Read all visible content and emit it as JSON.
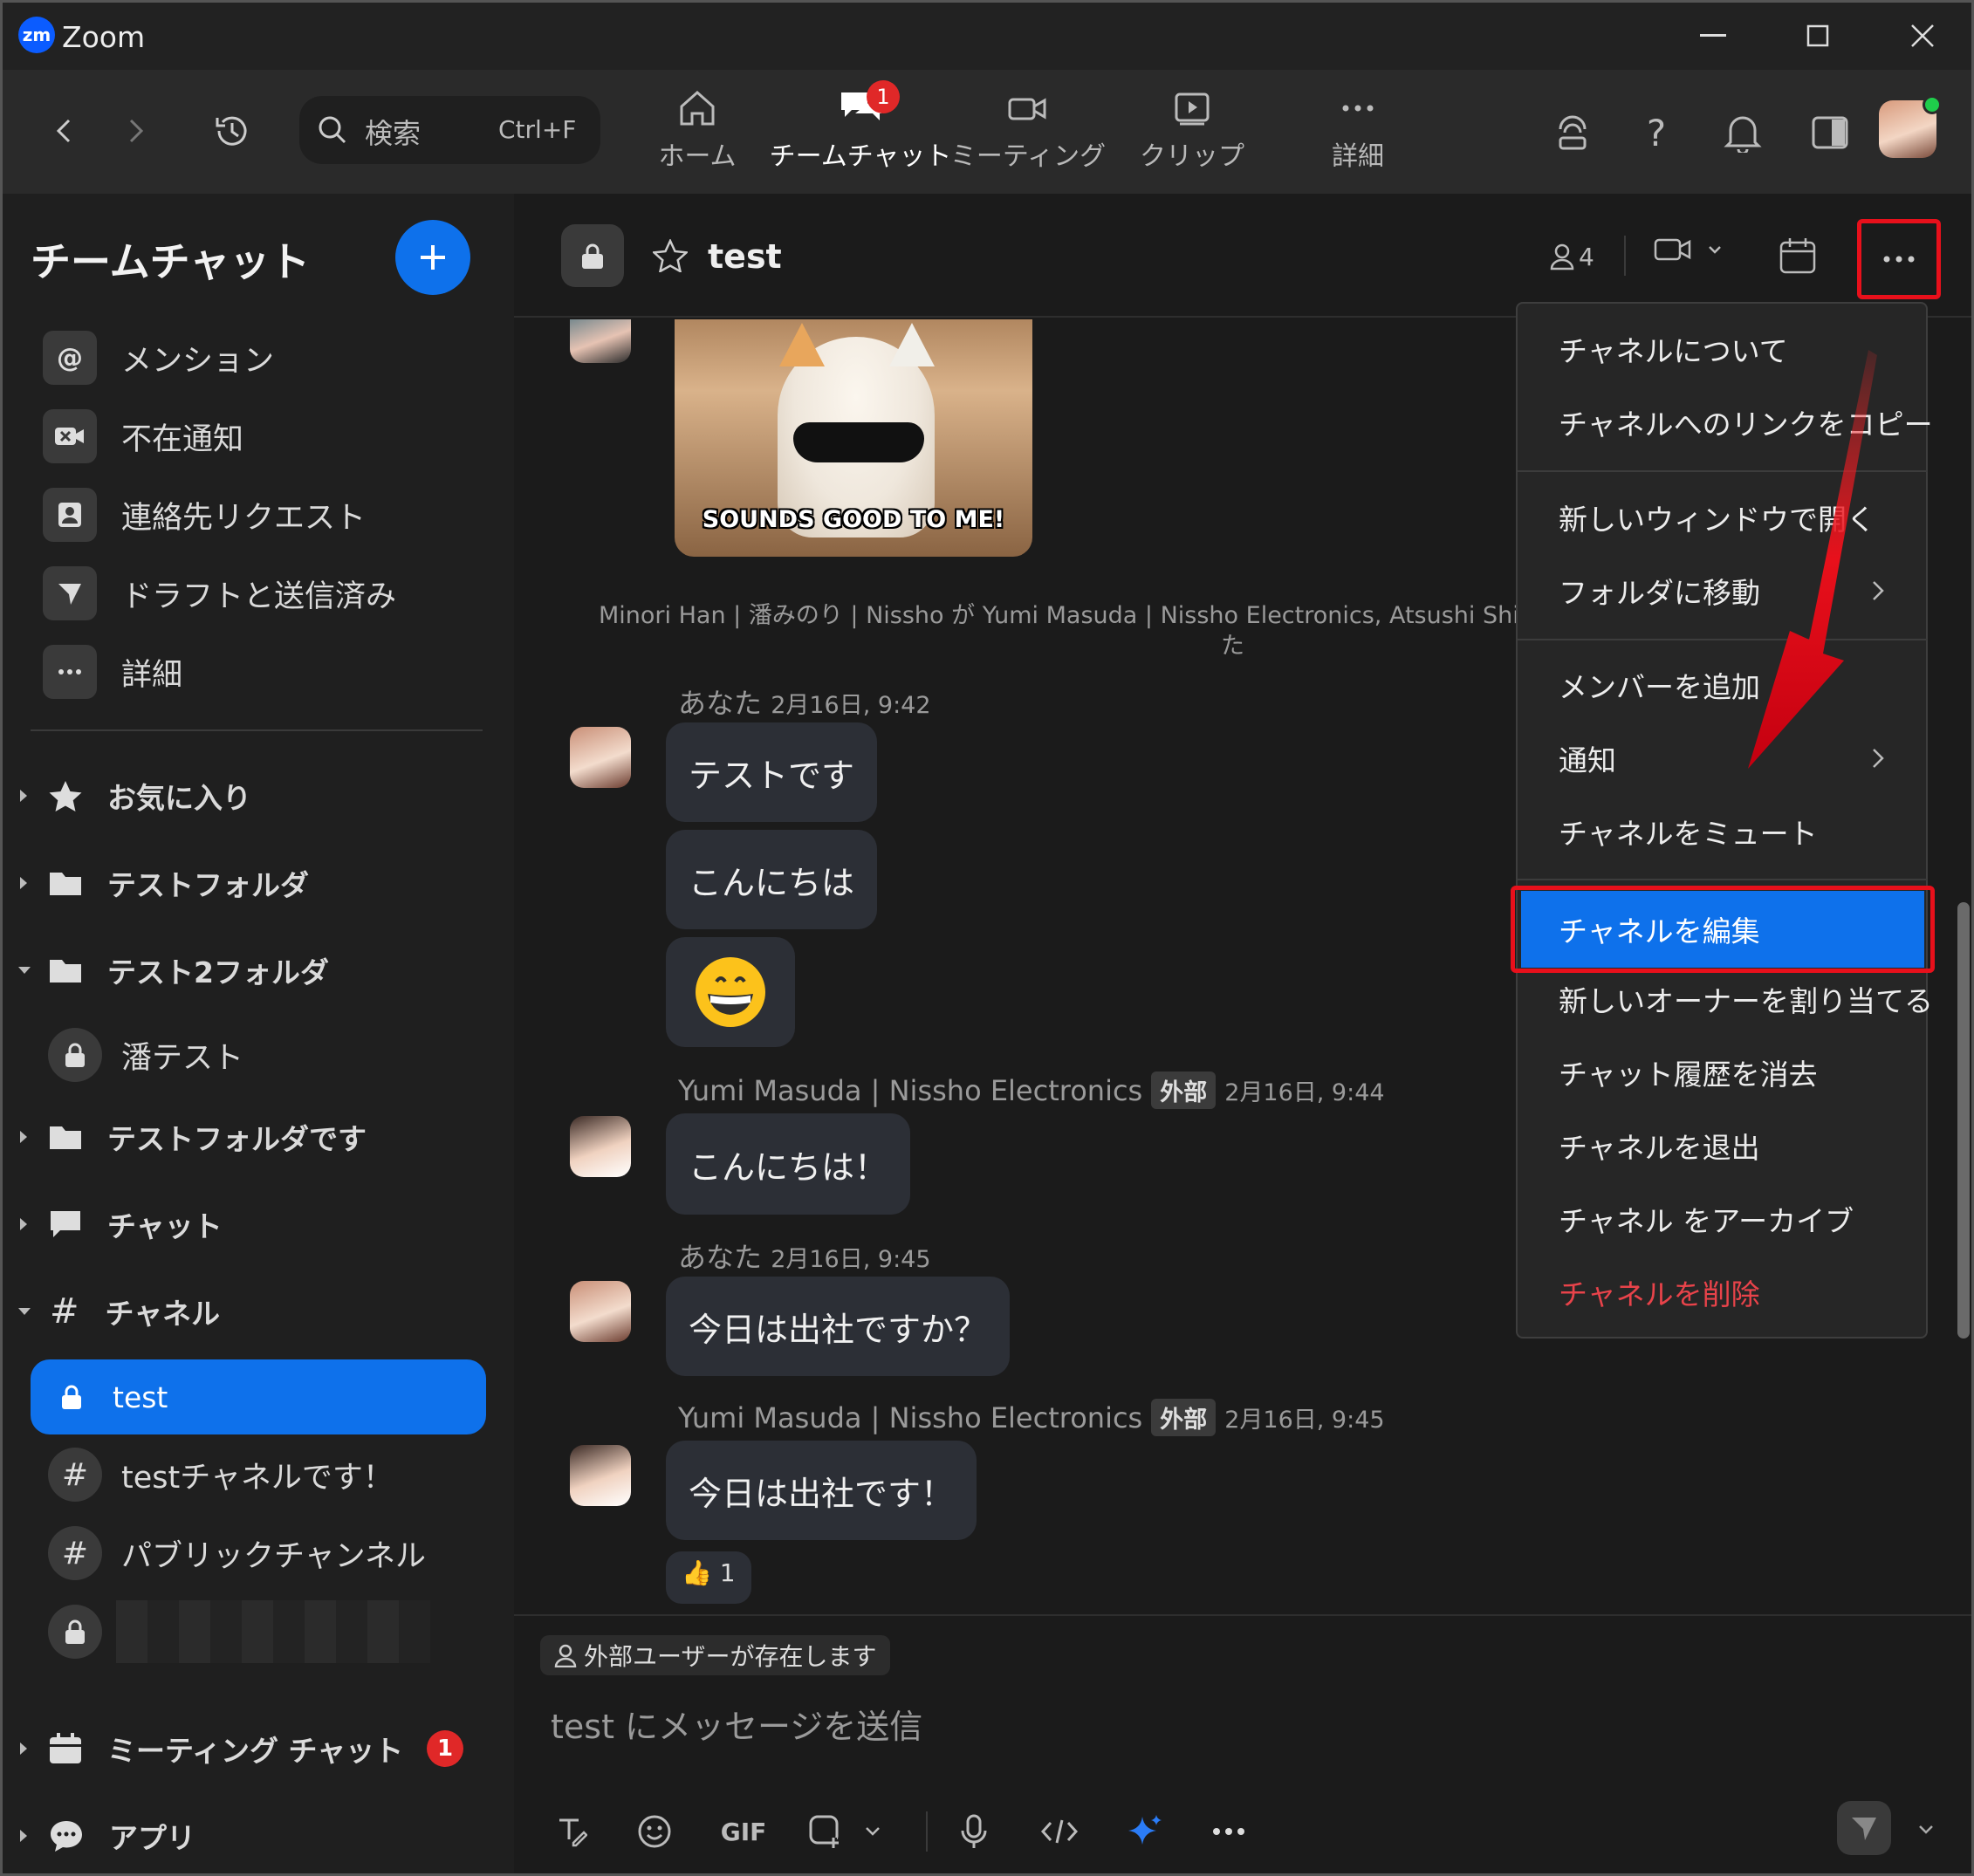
{
  "window": {
    "app_name": "Zoom",
    "logo": "zm"
  },
  "toolbar": {
    "search_placeholder": "検索",
    "search_shortcut": "Ctrl+F",
    "tabs": [
      {
        "label": "ホーム",
        "icon": "home-icon"
      },
      {
        "label": "チームチャット",
        "icon": "team-chat-icon",
        "badge": "1",
        "active": true
      },
      {
        "label": "ミーティング",
        "icon": "video-camera-icon"
      },
      {
        "label": "クリップ",
        "icon": "clip-icon"
      },
      {
        "label": "詳細",
        "icon": "more-dots-icon"
      }
    ]
  },
  "sidebar": {
    "title": "チームチャット",
    "quick_items": [
      {
        "label": "メンション",
        "icon": "at-icon"
      },
      {
        "label": "不在通知",
        "icon": "missed-video-icon"
      },
      {
        "label": "連絡先リクエスト",
        "icon": "contact-icon"
      },
      {
        "label": "ドラフトと送信済み",
        "icon": "send-icon"
      },
      {
        "label": "詳細",
        "icon": "more-dots-icon"
      }
    ],
    "sections": [
      {
        "label": "お気に入り",
        "icon": "star-icon",
        "expanded": false
      },
      {
        "label": "テストフォルダ",
        "icon": "folder-icon",
        "expanded": false
      },
      {
        "label": "テスト2フォルダ",
        "icon": "folder-icon",
        "expanded": true
      },
      {
        "label": "潘テスト",
        "icon": "lock-icon",
        "child": true
      },
      {
        "label": "テストフォルダです",
        "icon": "folder-icon",
        "expanded": false
      },
      {
        "label": "チャット",
        "icon": "chat-bubble-icon",
        "expanded": false
      },
      {
        "label": "チャネル",
        "icon": "hash-icon",
        "expanded": true
      }
    ],
    "channels": [
      {
        "label": "test",
        "icon": "lock-icon",
        "selected": true
      },
      {
        "label": "testチャネルです！",
        "icon": "hash-icon"
      },
      {
        "label": "パブリックチャンネル",
        "icon": "hash-icon"
      },
      {
        "label": "",
        "icon": "lock-icon",
        "redacted": true
      }
    ],
    "bottom_sections": [
      {
        "label": "ミーティング チャット",
        "icon": "calendar-icon",
        "badge": "1"
      },
      {
        "label": "アプリ",
        "icon": "app-bubble-icon"
      }
    ]
  },
  "channel_header": {
    "name": "test",
    "member_count": "4"
  },
  "messages": {
    "gif_caption": "SOUNDS GOOD TO ME!",
    "system_line_1": "Minori Han | 潘みのり | Nissho が Yumi Masuda | Nissho Electronics,  Atsushi Shibata",
    "system_line_2": "た",
    "groups": [
      {
        "sender": "あなた",
        "time": "2月16日, 9:42",
        "bubbles": [
          "テストです",
          "こんにちは",
          "😁"
        ]
      },
      {
        "sender": "Yumi Masuda | Nissho Electronics",
        "external": "外部",
        "time": "2月16日, 9:44",
        "bubbles": [
          "こんにちは！"
        ]
      },
      {
        "sender": "あなた",
        "time": "2月16日, 9:45",
        "bubbles": [
          "今日は出社ですか？"
        ]
      },
      {
        "sender": "Yumi Masuda | Nissho Electronics",
        "external": "外部",
        "time": "2月16日, 9:45",
        "bubbles": [
          "今日は出社です！"
        ],
        "reaction": "👍 1"
      }
    ]
  },
  "composer": {
    "external_notice": "外部ユーザーが存在します",
    "placeholder": "test にメッセージを送信",
    "gif_label": "GIF"
  },
  "context_menu": {
    "groups": [
      [
        "チャネルについて",
        "チャネルへのリンクをコピー"
      ],
      [
        "新しいウィンドウで開く",
        "フォルダに移動"
      ],
      [
        "メンバーを追加",
        "通知",
        "チャネルをミュート"
      ],
      [
        "チャネルを編集",
        "新しいオーナーを割り当てる",
        "チャット履歴を消去",
        "チャネルを退出",
        "チャネル をアーカイブ",
        "チャネルを削除"
      ]
    ],
    "highlighted": "チャネルを編集",
    "danger_item": "チャネルを削除",
    "accent_color": "#0e71eb",
    "danger_color": "#e8434a",
    "callout_color": "#e8101b"
  }
}
